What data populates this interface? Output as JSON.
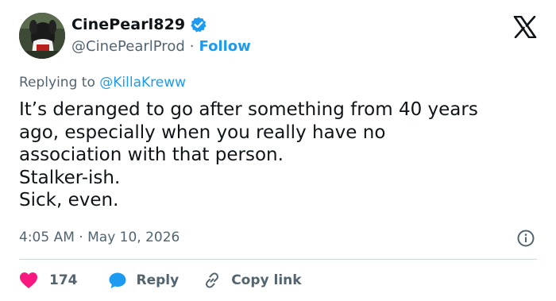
{
  "user": {
    "display_name": "CinePearl829",
    "handle": "@CinePearlProd",
    "separator": "·",
    "follow_label": "Follow",
    "verified_color": "#1d9bf0"
  },
  "reply_context": {
    "prefix": "Replying to ",
    "mention": "@KillaKreww"
  },
  "tweet": {
    "text": "It’s deranged to go after something from 40 years\nago, especially when you really have no\nassociation with that person.\nStalker-ish.\nSick, even."
  },
  "meta": {
    "time": "4:05 AM",
    "separator": "·",
    "date": "May 10, 2026"
  },
  "actions": {
    "like_count": "174",
    "reply_label": "Reply",
    "copy_label": "Copy link"
  },
  "icons": {
    "logo": "x-logo-icon",
    "verified": "verified-badge-icon",
    "info": "info-icon",
    "like": "heart-icon",
    "reply": "speech-bubble-icon",
    "copy": "link-icon"
  },
  "colors": {
    "accent": "#1d9bf0",
    "like": "#f91880",
    "muted": "#536471",
    "text": "#0f1419"
  }
}
